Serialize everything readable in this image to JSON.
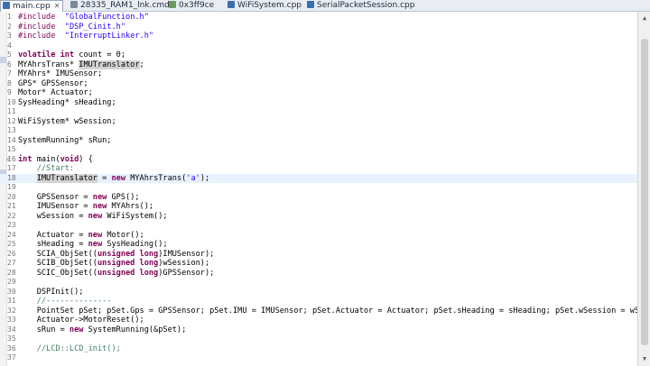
{
  "tabs": [
    {
      "label": "main.cpp",
      "icon": "cpp-file-icon",
      "active": true
    },
    {
      "label": "28335_RAM1_lnk.cmd",
      "icon": "cmd-file-icon",
      "active": false
    },
    {
      "label": "0x3ff9ce",
      "icon": "disassembly-icon",
      "active": false
    },
    {
      "label": "WiFiSystem.cpp",
      "icon": "cpp-file-icon",
      "active": false
    },
    {
      "label": "SerialPacketSession.cpp",
      "icon": "cpp-file-icon",
      "active": false
    }
  ],
  "close_glyph": "✕",
  "fold_glyph": "⊖",
  "current_line": 18,
  "code": [
    {
      "n": "1",
      "t": [
        [
          "p",
          "#include"
        ],
        [
          "",
          "  "
        ],
        [
          "s",
          "\"GlobalFunction.h\""
        ]
      ]
    },
    {
      "n": "2",
      "t": [
        [
          "p",
          "#include"
        ],
        [
          "",
          "  "
        ],
        [
          "s",
          "\"DSP_Cinit.h\""
        ]
      ]
    },
    {
      "n": "3",
      "t": [
        [
          "p",
          "#include"
        ],
        [
          "",
          "  "
        ],
        [
          "s",
          "\"InterruptLinker.h\""
        ]
      ]
    },
    {
      "n": "4",
      "t": []
    },
    {
      "n": "5",
      "t": [
        [
          "k",
          "volatile int"
        ],
        [
          "",
          " count = 0;"
        ]
      ]
    },
    {
      "n": "6",
      "t": [
        [
          "",
          "MYAhrsTrans* "
        ],
        [
          "hl",
          "IMUTranslator"
        ],
        [
          "",
          ";"
        ]
      ]
    },
    {
      "n": "7",
      "t": [
        [
          "",
          "MYAhrs* IMUSensor;"
        ]
      ]
    },
    {
      "n": "8",
      "t": [
        [
          "",
          "GPS* GPSSensor;"
        ]
      ]
    },
    {
      "n": "9",
      "t": [
        [
          "",
          "Motor* Actuator;"
        ]
      ]
    },
    {
      "n": "10",
      "t": [
        [
          "",
          "SysHeading* sHeading;"
        ]
      ]
    },
    {
      "n": "11",
      "t": []
    },
    {
      "n": "12",
      "t": [
        [
          "",
          "WiFiSystem* wSession;"
        ]
      ]
    },
    {
      "n": "13",
      "t": []
    },
    {
      "n": "14",
      "t": [
        [
          "",
          "SystemRunning* sRun;"
        ]
      ]
    },
    {
      "n": "15",
      "t": []
    },
    {
      "n": "16",
      "t": [
        [
          "k",
          "int"
        ],
        [
          "",
          " main("
        ],
        [
          "k",
          "void"
        ],
        [
          "",
          ") {"
        ]
      ],
      "fold": true
    },
    {
      "n": "17",
      "t": [
        [
          "",
          "    "
        ],
        [
          "c",
          "//Start:"
        ]
      ]
    },
    {
      "n": "18",
      "t": [
        [
          "",
          "    "
        ],
        [
          "hl",
          "IMUTranslator"
        ],
        [
          "",
          " = "
        ],
        [
          "k",
          "new"
        ],
        [
          "",
          " MYAhrsTrans("
        ],
        [
          "s",
          "'a'"
        ],
        [
          "",
          ");"
        ]
      ]
    },
    {
      "n": "19",
      "t": []
    },
    {
      "n": "20",
      "t": [
        [
          "",
          "    GPSSensor = "
        ],
        [
          "k",
          "new"
        ],
        [
          "",
          " GPS();"
        ]
      ]
    },
    {
      "n": "21",
      "t": [
        [
          "",
          "    IMUSensor = "
        ],
        [
          "k",
          "new"
        ],
        [
          "",
          " MYAhrs();"
        ]
      ]
    },
    {
      "n": "22",
      "t": [
        [
          "",
          "    wSession = "
        ],
        [
          "k",
          "new"
        ],
        [
          "",
          " WiFiSystem();"
        ]
      ]
    },
    {
      "n": "23",
      "t": []
    },
    {
      "n": "24",
      "t": [
        [
          "",
          "    Actuator = "
        ],
        [
          "k",
          "new"
        ],
        [
          "",
          " Motor();"
        ]
      ]
    },
    {
      "n": "25",
      "t": [
        [
          "",
          "    sHeading = "
        ],
        [
          "k",
          "new"
        ],
        [
          "",
          " SysHeading();"
        ]
      ]
    },
    {
      "n": "26",
      "t": [
        [
          "",
          "    SCIA_ObjSet(("
        ],
        [
          "k",
          "unsigned long"
        ],
        [
          "",
          ")IMUSensor);"
        ]
      ]
    },
    {
      "n": "27",
      "t": [
        [
          "",
          "    SCIB_ObjSet(("
        ],
        [
          "k",
          "unsigned long"
        ],
        [
          "",
          ")wSession);"
        ]
      ]
    },
    {
      "n": "28",
      "t": [
        [
          "",
          "    SCIC_ObjSet(("
        ],
        [
          "k",
          "unsigned long"
        ],
        [
          "",
          ")GPSSensor);"
        ]
      ]
    },
    {
      "n": "29",
      "t": []
    },
    {
      "n": "30",
      "t": [
        [
          "",
          "    DSPInit();"
        ]
      ]
    },
    {
      "n": "31",
      "t": [
        [
          "",
          "    "
        ],
        [
          "c",
          "//--------------"
        ]
      ]
    },
    {
      "n": "32",
      "t": [
        [
          "",
          "    PointSet pSet; pSet.Gps = GPSSensor; pSet.IMU = IMUSensor; pSet.Actuator = Actuator; pSet.sHeading = sHeading; pSet.wSession = wSession;"
        ]
      ]
    },
    {
      "n": "33",
      "t": [
        [
          "",
          "    Actuator->MotorReset();"
        ]
      ]
    },
    {
      "n": "34",
      "t": [
        [
          "",
          "    sRun = "
        ],
        [
          "k",
          "new"
        ],
        [
          "",
          " SystemRunning(&pSet);"
        ]
      ]
    },
    {
      "n": "35",
      "t": []
    },
    {
      "n": "36",
      "t": [
        [
          "",
          "    "
        ],
        [
          "c",
          "//LCD::LCD_init();"
        ]
      ]
    },
    {
      "n": "37",
      "t": []
    }
  ],
  "colors": {
    "keyword": "#7f0055",
    "string": "#2a00ff",
    "comment": "#3f7f5f",
    "current_line": "#e8f2fe"
  }
}
